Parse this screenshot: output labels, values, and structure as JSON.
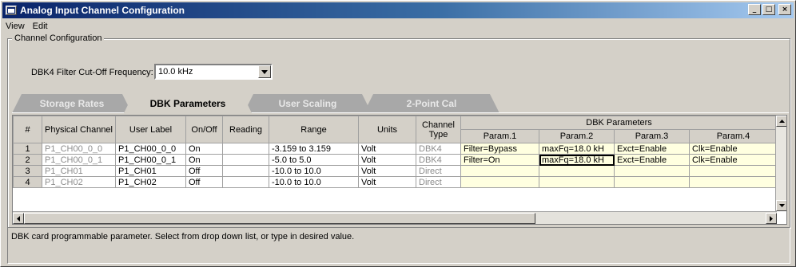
{
  "window": {
    "title": "Analog Input Channel Configuration",
    "buttons": {
      "minimize": "_",
      "maximize": "□",
      "close": "×"
    }
  },
  "menu": [
    "View",
    "Edit"
  ],
  "group": {
    "label": "Channel Configuration",
    "filter_label": "DBK4 Filter Cut-Off Frequency:",
    "filter_value": "10.0 kHz"
  },
  "tabs": [
    {
      "label": "Storage Rates",
      "active": false
    },
    {
      "label": "DBK Parameters",
      "active": true
    },
    {
      "label": "User Scaling",
      "active": false
    },
    {
      "label": "2-Point Cal",
      "active": false
    }
  ],
  "grid": {
    "headers": {
      "num": "#",
      "physical_channel": "Physical Channel",
      "user_label": "User Label",
      "on_off": "On/Off",
      "reading": "Reading",
      "range": "Range",
      "units": "Units",
      "channel_type": "Channel Type",
      "dbk_parameters": "DBK Parameters",
      "params": [
        "Param.1",
        "Param.2",
        "Param.3",
        "Param.4"
      ]
    },
    "rows": [
      {
        "num": "1",
        "physical": "P1_CH00_0_0",
        "label": "P1_CH00_0_0",
        "onoff": "On",
        "reading": "",
        "range": "-3.159 to 3.159",
        "units": "Volt",
        "type": "DBK4",
        "p1": "Filter=Bypass",
        "p2": "maxFq=18.0 kH",
        "p3": "Exct=Enable",
        "p4": "Clk=Enable"
      },
      {
        "num": "2",
        "physical": "P1_CH00_0_1",
        "label": "P1_CH00_0_1",
        "onoff": "On",
        "reading": "",
        "range": "-5.0 to 5.0",
        "units": "Volt",
        "type": "DBK4",
        "p1": "Filter=On",
        "p2": "maxFq=18.0 kH",
        "p3": "Exct=Enable",
        "p4": "Clk=Enable"
      },
      {
        "num": "3",
        "physical": "P1_CH01",
        "label": "P1_CH01",
        "onoff": "Off",
        "reading": "",
        "range": "-10.0 to 10.0",
        "units": "Volt",
        "type": "Direct",
        "p1": "",
        "p2": "",
        "p3": "",
        "p4": ""
      },
      {
        "num": "4",
        "physical": "P1_CH02",
        "label": "P1_CH02",
        "onoff": "Off",
        "reading": "",
        "range": "-10.0 to 10.0",
        "units": "Volt",
        "type": "Direct",
        "p1": "",
        "p2": "",
        "p3": "",
        "p4": ""
      }
    ]
  },
  "status": {
    "text": "DBK card programmable parameter. Select from drop down list, or type in desired value."
  },
  "colors": {
    "title_gradient_start": "#0a246a",
    "title_gradient_end": "#a6caf0",
    "param_highlight": "#ffffe0",
    "inactive_tab": "#a8a8a8",
    "face": "#d4d0c8"
  },
  "icons": {
    "app": "window-icon",
    "dropdown": "chevron-down-icon",
    "scroll_up": "arrow-up-icon",
    "scroll_down": "arrow-down-icon",
    "scroll_left": "arrow-left-icon",
    "scroll_right": "arrow-right-icon"
  }
}
